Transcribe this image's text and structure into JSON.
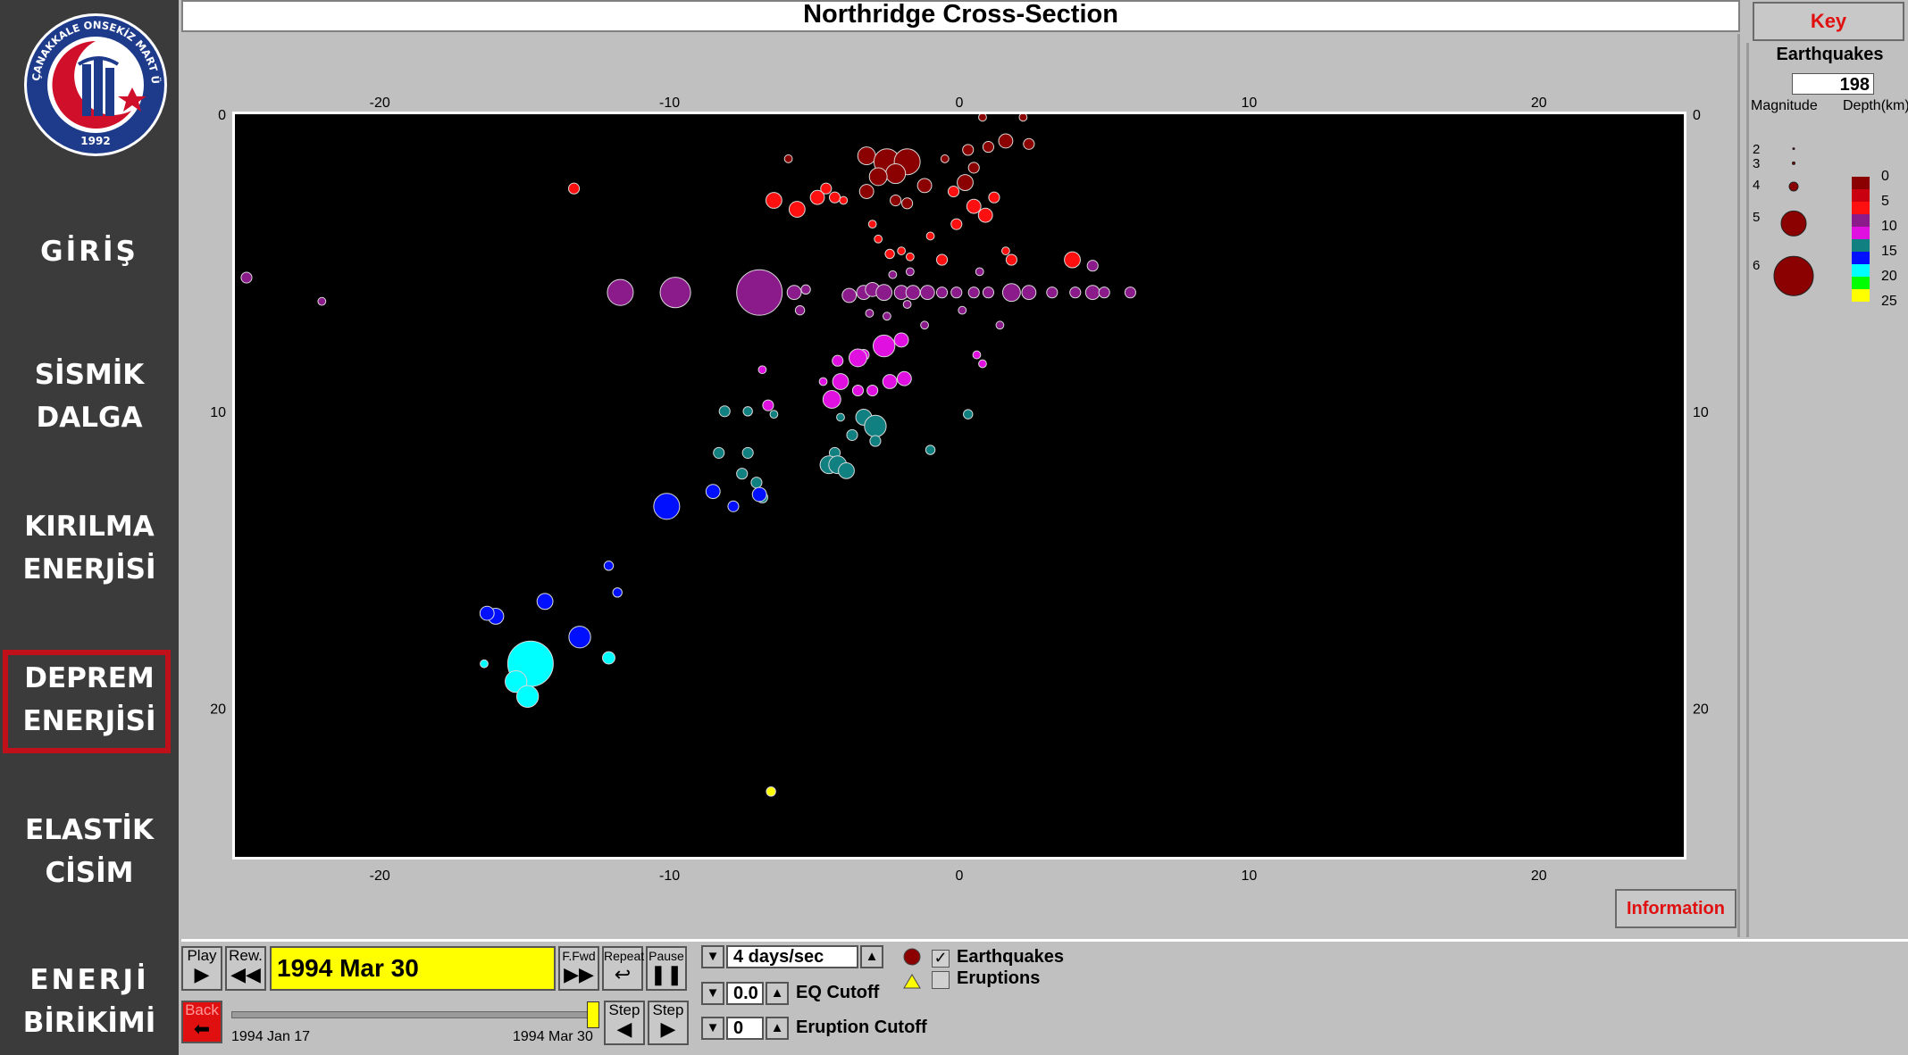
{
  "app": {
    "title": "Northridge Cross-Section"
  },
  "logo": {
    "text_top": "ÇANAKKALE ONSEKİZ MART ÜNİVERSİTESİ",
    "year": "1992"
  },
  "sidebar": {
    "items": [
      {
        "lines": [
          "GİRİŞ"
        ]
      },
      {
        "lines": [
          "SİSMİK",
          "DALGA"
        ]
      },
      {
        "lines": [
          "KIRILMA",
          "ENERJİSİ"
        ]
      },
      {
        "lines": [
          "DEPREM",
          "ENERJİSİ"
        ],
        "active": true
      },
      {
        "lines": [
          "ELASTİK",
          "CİSİM"
        ]
      },
      {
        "lines": [
          "ENERJİ",
          "BİRİKİMİ"
        ]
      }
    ],
    "active_color": "#c0101a"
  },
  "key": {
    "button_label": "Key",
    "earthquakes_label": "Earthquakes",
    "earthquake_count": "198",
    "magnitude_header": "Magnitude",
    "depth_header": "Depth(km)",
    "magnitudes": [
      "2",
      "3",
      "4",
      "5",
      "6"
    ],
    "depths": [
      "0",
      "5",
      "10",
      "15",
      "20",
      "25"
    ],
    "depth_colors": [
      "#8b0000",
      "#ff1010",
      "#8b1a8b",
      "#e010e0",
      "#108080",
      "#0010ff",
      "#00ffff",
      "#00ff00",
      "#ffff00"
    ]
  },
  "chart_data": {
    "type": "scatter",
    "title": "Northridge Cross-Section",
    "x_ticks": [
      "-20",
      "-10",
      "0",
      "10",
      "20"
    ],
    "y_ticks": [
      "0",
      "10",
      "20"
    ],
    "xlim": [
      -25,
      25
    ],
    "ylim": [
      0,
      25
    ],
    "y_inverted": true,
    "grid": false,
    "background": "#000000",
    "size_encodes": "magnitude",
    "color_encodes": "depth_km",
    "points": [
      [
        0.8,
        0.1,
        2.8,
        2
      ],
      [
        2.2,
        0.1,
        2.8,
        2
      ],
      [
        1.6,
        0.9,
        3.2,
        2
      ],
      [
        2.4,
        1.0,
        3.0,
        2
      ],
      [
        1.0,
        1.1,
        3.0,
        2
      ],
      [
        0.3,
        1.2,
        3.0,
        2
      ],
      [
        -0.5,
        1.5,
        2.8,
        2
      ],
      [
        -3.2,
        1.4,
        3.4,
        2
      ],
      [
        -2.5,
        1.6,
        3.8,
        2
      ],
      [
        -1.8,
        1.6,
        3.8,
        2
      ],
      [
        -2.2,
        2.0,
        3.5,
        2
      ],
      [
        -2.8,
        2.1,
        3.4,
        2
      ],
      [
        0.5,
        1.8,
        3.0,
        2
      ],
      [
        0.2,
        2.3,
        3.3,
        2
      ],
      [
        -1.2,
        2.4,
        3.2,
        2
      ],
      [
        -3.2,
        2.6,
        3.2,
        2
      ],
      [
        -2.2,
        2.9,
        3.0,
        2
      ],
      [
        -1.8,
        3.0,
        3.0,
        2
      ],
      [
        -5.9,
        1.5,
        2.8,
        2
      ],
      [
        -13.3,
        2.5,
        3.0,
        5
      ],
      [
        -6.4,
        2.9,
        3.3,
        5
      ],
      [
        -5.6,
        3.2,
        3.3,
        5
      ],
      [
        -4.9,
        2.8,
        3.2,
        5
      ],
      [
        -4.6,
        2.5,
        3.0,
        5
      ],
      [
        -4.3,
        2.8,
        3.0,
        5
      ],
      [
        -4.0,
        2.9,
        2.8,
        5
      ],
      [
        -0.2,
        2.6,
        3.0,
        5
      ],
      [
        1.2,
        2.8,
        3.0,
        5
      ],
      [
        0.9,
        3.4,
        3.2,
        5
      ],
      [
        0.5,
        3.1,
        3.2,
        5
      ],
      [
        -0.1,
        3.7,
        3.0,
        5
      ],
      [
        -3.0,
        3.7,
        2.8,
        5
      ],
      [
        -1.0,
        4.1,
        2.8,
        5
      ],
      [
        -2.8,
        4.2,
        2.8,
        5
      ],
      [
        -2.4,
        4.7,
        2.9,
        5
      ],
      [
        -2.0,
        4.6,
        2.8,
        5
      ],
      [
        -1.7,
        4.8,
        2.8,
        5
      ],
      [
        -0.6,
        4.9,
        3.0,
        5
      ],
      [
        1.6,
        4.6,
        2.8,
        5
      ],
      [
        1.8,
        4.9,
        3.0,
        5
      ],
      [
        3.9,
        4.9,
        3.3,
        5
      ],
      [
        -24.6,
        5.5,
        3.0,
        10
      ],
      [
        -22.0,
        6.3,
        2.8,
        10
      ],
      [
        -11.7,
        6.0,
        3.8,
        10
      ],
      [
        -9.8,
        6.0,
        4.0,
        10
      ],
      [
        -6.9,
        6.0,
        4.6,
        10
      ],
      [
        -5.7,
        6.0,
        3.2,
        10
      ],
      [
        -5.3,
        5.9,
        2.9,
        10
      ],
      [
        -5.5,
        6.6,
        2.9,
        10
      ],
      [
        -3.8,
        6.1,
        3.2,
        10
      ],
      [
        -3.3,
        6.0,
        3.2,
        10
      ],
      [
        -3.0,
        5.9,
        3.2,
        10
      ],
      [
        -2.6,
        6.0,
        3.3,
        10
      ],
      [
        -2.0,
        6.0,
        3.2,
        10
      ],
      [
        -1.6,
        6.0,
        3.2,
        10
      ],
      [
        -1.1,
        6.0,
        3.2,
        10
      ],
      [
        -0.6,
        6.0,
        3.0,
        10
      ],
      [
        -0.1,
        6.0,
        3.0,
        10
      ],
      [
        0.5,
        6.0,
        3.0,
        10
      ],
      [
        1.0,
        6.0,
        3.0,
        10
      ],
      [
        1.8,
        6.0,
        3.4,
        10
      ],
      [
        2.4,
        6.0,
        3.2,
        10
      ],
      [
        3.2,
        6.0,
        3.0,
        10
      ],
      [
        4.0,
        6.0,
        3.0,
        10
      ],
      [
        4.6,
        6.0,
        3.2,
        10
      ],
      [
        5.0,
        6.0,
        3.0,
        10
      ],
      [
        5.9,
        6.0,
        3.0,
        10
      ],
      [
        4.6,
        5.1,
        3.0,
        10
      ],
      [
        -2.3,
        5.4,
        2.8,
        10
      ],
      [
        -1.7,
        5.3,
        2.8,
        10
      ],
      [
        0.7,
        5.3,
        2.8,
        10
      ],
      [
        -3.1,
        6.7,
        2.8,
        10
      ],
      [
        -2.5,
        6.8,
        2.8,
        10
      ],
      [
        -1.2,
        7.1,
        2.8,
        10
      ],
      [
        0.1,
        6.6,
        2.8,
        10
      ],
      [
        1.4,
        7.1,
        2.8,
        10
      ],
      [
        -1.8,
        6.4,
        2.8,
        10
      ],
      [
        -2.6,
        7.8,
        3.6,
        15
      ],
      [
        -2.0,
        7.6,
        3.2,
        15
      ],
      [
        -3.3,
        8.1,
        3.0,
        15
      ],
      [
        -3.5,
        8.2,
        3.4,
        15
      ],
      [
        -4.2,
        8.3,
        3.0,
        15
      ],
      [
        -4.1,
        9.0,
        3.3,
        15
      ],
      [
        -4.4,
        9.6,
        3.4,
        15
      ],
      [
        -3.5,
        9.3,
        3.0,
        15
      ],
      [
        -3.0,
        9.3,
        3.0,
        15
      ],
      [
        -2.4,
        9.0,
        3.2,
        15
      ],
      [
        -1.9,
        8.9,
        3.2,
        15
      ],
      [
        -6.8,
        8.6,
        2.8,
        15
      ],
      [
        -6.6,
        9.8,
        3.0,
        15
      ],
      [
        -4.7,
        9.0,
        2.8,
        15
      ],
      [
        0.6,
        8.1,
        2.8,
        15
      ],
      [
        0.8,
        8.4,
        2.8,
        15
      ],
      [
        -8.1,
        10.0,
        3.0,
        20
      ],
      [
        -7.3,
        10.0,
        2.9,
        20
      ],
      [
        -6.4,
        10.1,
        2.8,
        20
      ],
      [
        -4.1,
        10.2,
        2.8,
        20
      ],
      [
        -3.3,
        10.2,
        3.3,
        20
      ],
      [
        -2.9,
        10.5,
        3.6,
        20
      ],
      [
        -3.7,
        10.8,
        3.0,
        20
      ],
      [
        -2.9,
        11.0,
        3.0,
        20
      ],
      [
        -4.3,
        11.4,
        3.0,
        20
      ],
      [
        -4.5,
        11.8,
        3.4,
        20
      ],
      [
        -4.2,
        11.8,
        3.4,
        20
      ],
      [
        -3.9,
        12.0,
        3.3,
        20
      ],
      [
        -1.0,
        11.3,
        2.9,
        20
      ],
      [
        0.3,
        10.1,
        2.9,
        20
      ],
      [
        -7.3,
        11.4,
        3.0,
        20
      ],
      [
        -8.3,
        11.4,
        3.0,
        20
      ],
      [
        -7.5,
        12.1,
        3.0,
        20
      ],
      [
        -7.0,
        12.4,
        3.0,
        20
      ],
      [
        -6.8,
        12.9,
        3.0,
        20
      ],
      [
        -8.5,
        12.7,
        3.2,
        25
      ],
      [
        -6.9,
        12.8,
        3.2,
        25
      ],
      [
        -7.8,
        13.2,
        3.0,
        25
      ],
      [
        -10.1,
        13.2,
        3.8,
        25
      ],
      [
        -12.1,
        15.2,
        2.9,
        25
      ],
      [
        -11.8,
        16.1,
        2.9,
        25
      ],
      [
        -16.0,
        16.9,
        3.3,
        25
      ],
      [
        -16.3,
        16.8,
        3.2,
        25
      ],
      [
        -14.3,
        16.4,
        3.3,
        25
      ],
      [
        -13.1,
        17.6,
        3.6,
        25
      ],
      [
        -14.8,
        18.5,
        4.6,
        30
      ],
      [
        -15.3,
        19.1,
        3.6,
        30
      ],
      [
        -14.9,
        19.6,
        3.6,
        30
      ],
      [
        -12.1,
        18.3,
        3.1,
        30
      ],
      [
        -16.4,
        18.5,
        2.8,
        30
      ],
      [
        -6.5,
        22.8,
        2.9,
        35
      ]
    ]
  },
  "controls": {
    "play_label": "Play",
    "rew_label": "Rew.",
    "current_date": "1994 Mar 30",
    "ffwd_label": "F.Fwd",
    "repeat_label": "Repeat",
    "pause_label": "Pause",
    "speed": "4 days/sec",
    "back_label": "Back",
    "step_back_label": "Step",
    "step_fwd_label": "Step",
    "start_date": "1994 Jan 17",
    "end_date": "1994 Mar 30",
    "progress_fraction": 1.0,
    "eq_cutoff_value": "0.0",
    "eq_cutoff_label": "EQ Cutoff",
    "eruption_cutoff_value": "0",
    "eruption_cutoff_label": "Eruption Cutoff",
    "earthquakes_label": "Earthquakes",
    "earthquakes_checked": true,
    "eruptions_label": "Eruptions",
    "eruptions_checked": false
  },
  "information_label": "Information"
}
